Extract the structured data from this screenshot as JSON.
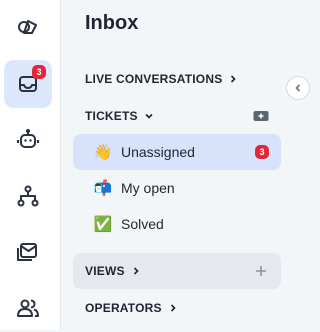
{
  "rail": {
    "items": [
      {
        "icon": "shapes-icon"
      },
      {
        "icon": "inbox-icon",
        "badge": "3"
      },
      {
        "icon": "bot-icon"
      },
      {
        "icon": "workflow-icon"
      },
      {
        "icon": "mail-campaign-icon"
      },
      {
        "icon": "contacts-icon"
      }
    ]
  },
  "panel": {
    "title": "Inbox",
    "live_conversations_label": "LIVE CONVERSATIONS",
    "tickets_label": "TICKETS",
    "tickets_items": [
      {
        "emoji": "👋",
        "label": "Unassigned",
        "count": "3"
      },
      {
        "emoji": "📬",
        "label": "My open"
      },
      {
        "emoji": "✅",
        "label": "Solved"
      }
    ],
    "views_label": "VIEWS",
    "operators_label": "OPERATORS"
  },
  "colors": {
    "accent": "#dde7fb",
    "selected": "#d6e3fa",
    "badge": "#e3263a",
    "text": "#1f2530"
  }
}
